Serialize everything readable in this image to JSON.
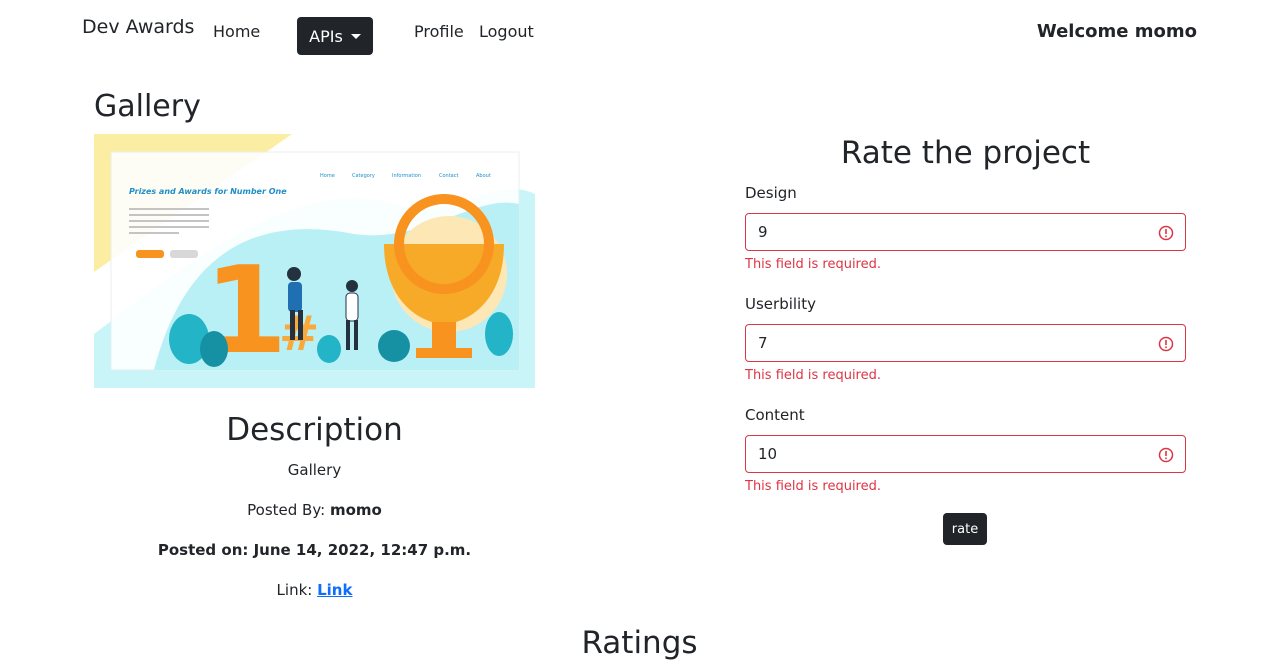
{
  "nav": {
    "brand": "Dev Awards",
    "home": "Home",
    "apis": "APIs",
    "profile": "Profile",
    "logout": "Logout",
    "welcome": "Welcome momo"
  },
  "gallery": {
    "title": "Gallery",
    "image": {
      "headline": "Prizes and Awards for Number One",
      "menu": [
        "Home",
        "Category",
        "Information",
        "Contact",
        "About"
      ],
      "number": "1",
      "hash": "#"
    }
  },
  "description": {
    "title": "Description",
    "text": "Gallery",
    "posted_by_label": "Posted By: ",
    "posted_by": "momo",
    "posted_on": "Posted on: June 14, 2022, 12:47 p.m.",
    "link_label": "Link: ",
    "link_text": " Link"
  },
  "rating_form": {
    "title": "Rate the project",
    "fields": [
      {
        "label": "Design",
        "value": "9",
        "error": "This field is required."
      },
      {
        "label": "Userbility",
        "value": "7",
        "error": "This field is required."
      },
      {
        "label": "Content",
        "value": "10",
        "error": "This field is required."
      }
    ],
    "submit": "rate"
  },
  "ratings": {
    "title": "Ratings"
  },
  "colors": {
    "dark": "#212529",
    "danger": "#dc3545",
    "link": "#0d6efd",
    "accent_orange": "#f7931e",
    "accent_cyan": "#bdf3f7"
  }
}
